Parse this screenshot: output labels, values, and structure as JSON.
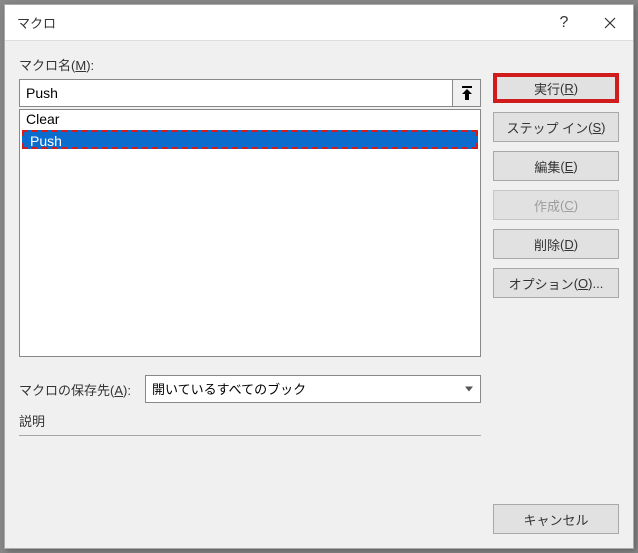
{
  "dialog": {
    "title": "マクロ"
  },
  "labels": {
    "macroName": "マクロ名",
    "macroNameAccel": "M",
    "storage": "マクロの保存先",
    "storageAccel": "A",
    "description": "説明"
  },
  "fields": {
    "macroNameValue": "Push",
    "storageSelected": "開いているすべてのブック"
  },
  "list": {
    "items": [
      "Clear",
      "Push"
    ],
    "selectedIndex": 1
  },
  "buttons": {
    "run": "実行",
    "runAccel": "R",
    "stepIn": "ステップ イン",
    "stepInAccel": "S",
    "edit": "編集",
    "editAccel": "E",
    "create": "作成",
    "createAccel": "C",
    "delete": "削除",
    "deleteAccel": "D",
    "options": "オプション",
    "optionsAccel": "O",
    "cancel": "キャンセル"
  },
  "colors": {
    "highlight": "#d01c1c",
    "selection": "#0b6cce"
  }
}
